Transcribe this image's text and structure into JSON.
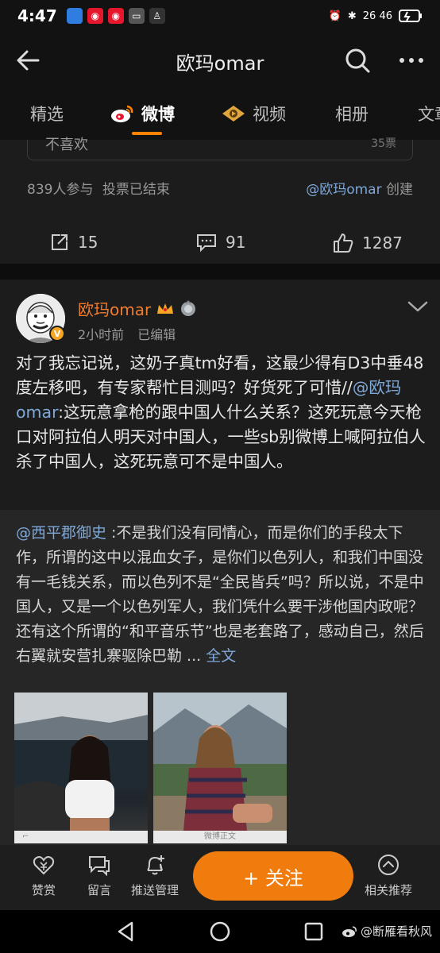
{
  "status": {
    "time": "4:47",
    "network": "26 46",
    "icons": [
      "weibo-icon",
      "weibo-icon",
      "weibo-icon",
      "message-icon",
      "qq-icon"
    ]
  },
  "header": {
    "title": "欧玛omar"
  },
  "tabs": [
    {
      "label": "精选",
      "active": false
    },
    {
      "label": "微博",
      "active": true
    },
    {
      "label": "视频",
      "active": false
    },
    {
      "label": "相册",
      "active": false
    },
    {
      "label": "文章",
      "active": false
    }
  ],
  "poll": {
    "option_text": "不喜欢",
    "option_count": "35票",
    "participants": "839人参与",
    "status": "投票已结束",
    "creator_link": "@欧玛omar",
    "creator_suffix": "创建"
  },
  "actions": {
    "repost": "15",
    "comment": "91",
    "like": "1287"
  },
  "post": {
    "username": "欧玛omar",
    "time": "2小时前",
    "edited": "已编辑",
    "text_part1": "对了我忘记说，这奶子真tm好看，这最少得有D3中垂48度左移吧，有专家帮忙目测吗？好货死了可惜//",
    "text_mention": "@欧玛omar",
    "text_part2": ":这玩意拿枪的跟中国人什么关系？这死玩意今天枪口对阿拉伯人明天对中国人，一些sb别微博上喊阿拉伯人杀了中国人，这死玩意可不是中国人。"
  },
  "repost": {
    "mention": "@西平郡御史",
    "text": " :不是我们没有同情心，而是你们的手段太下作，所谓的这中以混血女子，是你们以色列人，和我们中国没有一毛钱关系，而以色列不是“全民皆兵”吗？所以说，不是中国人，又是一个以色列军人，我们凭什么要干涉他国内政呢？还有这个所谓的“和平音乐节”也是老套路了，感动自己，然后右翼就安营扎寨驱除巴勒 ... ",
    "full_link": "全文",
    "image2_caption": "微博正文"
  },
  "bottombar": {
    "reward": "赞赏",
    "message": "留言",
    "push": "推送管理",
    "follow": "+ 关注",
    "recommend": "相关推荐"
  },
  "watermark": "@断雁看秋风"
}
